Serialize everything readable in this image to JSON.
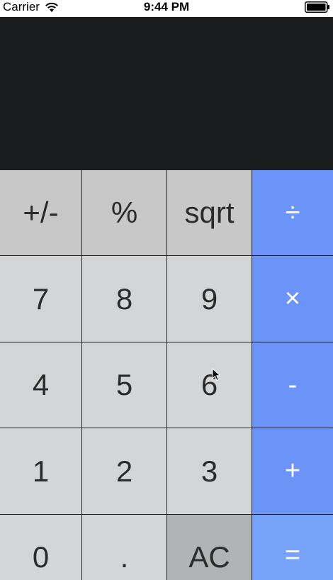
{
  "status_bar": {
    "carrier": "Carrier",
    "time": "9:44 PM",
    "wifi_icon": "wifi-icon",
    "battery_icon": "battery-full-icon"
  },
  "display": {
    "value": ""
  },
  "keypad": {
    "rows": [
      [
        {
          "label": "+/-",
          "name": "sign-toggle-button",
          "kind": "fn"
        },
        {
          "label": "%",
          "name": "percent-button",
          "kind": "fn"
        },
        {
          "label": "sqrt",
          "name": "sqrt-button",
          "kind": "fn"
        },
        {
          "label": "÷",
          "name": "divide-button",
          "kind": "op"
        }
      ],
      [
        {
          "label": "7",
          "name": "digit-7-button",
          "kind": "num"
        },
        {
          "label": "8",
          "name": "digit-8-button",
          "kind": "num"
        },
        {
          "label": "9",
          "name": "digit-9-button",
          "kind": "num"
        },
        {
          "label": "×",
          "name": "multiply-button",
          "kind": "op"
        }
      ],
      [
        {
          "label": "4",
          "name": "digit-4-button",
          "kind": "num"
        },
        {
          "label": "5",
          "name": "digit-5-button",
          "kind": "num"
        },
        {
          "label": "6",
          "name": "digit-6-button",
          "kind": "num"
        },
        {
          "label": "-",
          "name": "subtract-button",
          "kind": "op"
        }
      ],
      [
        {
          "label": "1",
          "name": "digit-1-button",
          "kind": "num"
        },
        {
          "label": "2",
          "name": "digit-2-button",
          "kind": "num"
        },
        {
          "label": "3",
          "name": "digit-3-button",
          "kind": "num"
        },
        {
          "label": "+",
          "name": "add-button",
          "kind": "op"
        }
      ],
      [
        {
          "label": "0",
          "name": "digit-0-button",
          "kind": "num"
        },
        {
          "label": ".",
          "name": "decimal-button",
          "kind": "num"
        },
        {
          "label": "AC",
          "name": "all-clear-button",
          "kind": "clear"
        },
        {
          "label": "=",
          "name": "equals-button",
          "kind": "eq"
        }
      ]
    ]
  },
  "colors": {
    "display_bg": "#1b1c1e",
    "function_key": "#c8c8c9",
    "number_key": "#d4d5d6",
    "clear_key": "#b2b3b4",
    "operator_key": "#6c94f8",
    "equals_key": "#77a2fa"
  }
}
